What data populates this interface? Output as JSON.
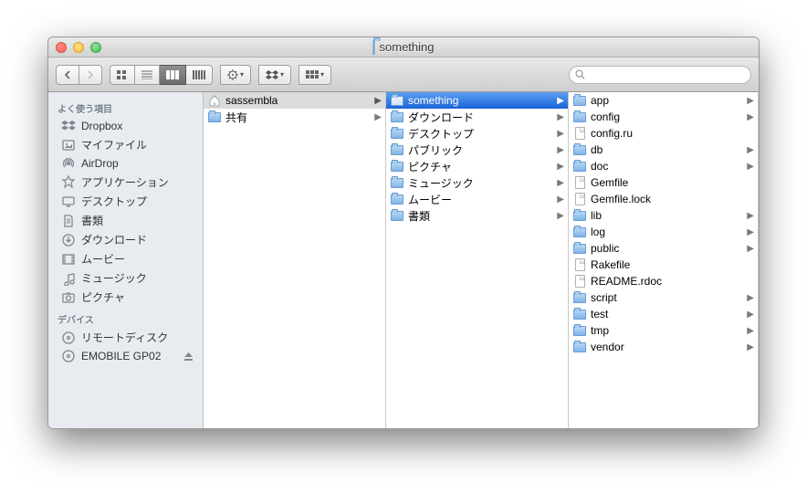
{
  "window": {
    "title": "something"
  },
  "search": {
    "placeholder": ""
  },
  "sidebar": {
    "sections": [
      {
        "header": "よく使う項目",
        "items": [
          {
            "icon": "dropbox",
            "label": "Dropbox"
          },
          {
            "icon": "myfiles",
            "label": "マイファイル"
          },
          {
            "icon": "airdrop",
            "label": "AirDrop"
          },
          {
            "icon": "apps",
            "label": "アプリケーション"
          },
          {
            "icon": "desktop",
            "label": "デスクトップ"
          },
          {
            "icon": "documents",
            "label": "書類"
          },
          {
            "icon": "downloads",
            "label": "ダウンロード"
          },
          {
            "icon": "movies",
            "label": "ムービー"
          },
          {
            "icon": "music",
            "label": "ミュージック"
          },
          {
            "icon": "pictures",
            "label": "ピクチャ"
          }
        ]
      },
      {
        "header": "デバイス",
        "items": [
          {
            "icon": "disc",
            "label": "リモートディスク"
          },
          {
            "icon": "disc",
            "label": "EMOBILE GP02",
            "eject": true
          }
        ]
      }
    ]
  },
  "columns": [
    {
      "items": [
        {
          "icon": "home",
          "label": "sassembla",
          "arrow": true,
          "selected": "dim"
        },
        {
          "icon": "folder",
          "label": "共有",
          "arrow": true
        }
      ]
    },
    {
      "items": [
        {
          "icon": "folder",
          "label": "something",
          "arrow": true,
          "selected": "active"
        },
        {
          "icon": "folder",
          "label": "ダウンロード",
          "arrow": true
        },
        {
          "icon": "folder",
          "label": "デスクトップ",
          "arrow": true
        },
        {
          "icon": "folder",
          "label": "パブリック",
          "arrow": true
        },
        {
          "icon": "folder",
          "label": "ピクチャ",
          "arrow": true
        },
        {
          "icon": "folder",
          "label": "ミュージック",
          "arrow": true
        },
        {
          "icon": "folder",
          "label": "ムービー",
          "arrow": true
        },
        {
          "icon": "folder",
          "label": "書類",
          "arrow": true
        }
      ]
    },
    {
      "items": [
        {
          "icon": "folder",
          "label": "app",
          "arrow": true
        },
        {
          "icon": "folder",
          "label": "config",
          "arrow": true
        },
        {
          "icon": "file",
          "label": "config.ru"
        },
        {
          "icon": "folder",
          "label": "db",
          "arrow": true
        },
        {
          "icon": "folder",
          "label": "doc",
          "arrow": true
        },
        {
          "icon": "file",
          "label": "Gemfile"
        },
        {
          "icon": "file",
          "label": "Gemfile.lock"
        },
        {
          "icon": "folder",
          "label": "lib",
          "arrow": true
        },
        {
          "icon": "folder",
          "label": "log",
          "arrow": true
        },
        {
          "icon": "folder",
          "label": "public",
          "arrow": true
        },
        {
          "icon": "file",
          "label": "Rakefile"
        },
        {
          "icon": "file",
          "label": "README.rdoc"
        },
        {
          "icon": "folder",
          "label": "script",
          "arrow": true
        },
        {
          "icon": "folder",
          "label": "test",
          "arrow": true
        },
        {
          "icon": "folder",
          "label": "tmp",
          "arrow": true
        },
        {
          "icon": "folder",
          "label": "vendor",
          "arrow": true
        }
      ]
    }
  ]
}
